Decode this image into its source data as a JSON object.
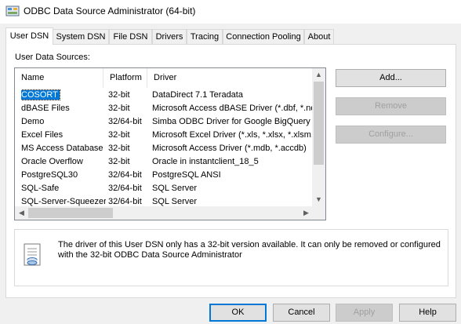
{
  "window": {
    "title": "ODBC Data Source Administrator (64-bit)"
  },
  "tabs": [
    {
      "label": "User DSN",
      "active": true
    },
    {
      "label": "System DSN"
    },
    {
      "label": "File DSN"
    },
    {
      "label": "Drivers"
    },
    {
      "label": "Tracing"
    },
    {
      "label": "Connection Pooling"
    },
    {
      "label": "About"
    }
  ],
  "user_dsn": {
    "section_label": "User Data Sources:",
    "columns": [
      "Name",
      "Platform",
      "Driver"
    ],
    "rows": [
      {
        "name": "COSORT",
        "platform": "32-bit",
        "driver": "DataDirect 7.1 Teradata"
      },
      {
        "name": "dBASE Files",
        "platform": "32-bit",
        "driver": "Microsoft Access dBASE Driver (*.dbf, *.ndx"
      },
      {
        "name": "Demo",
        "platform": "32/64-bit",
        "driver": "Simba ODBC Driver for Google BigQuery"
      },
      {
        "name": "Excel Files",
        "platform": "32-bit",
        "driver": "Microsoft Excel Driver (*.xls, *.xlsx, *.xlsm, *.x"
      },
      {
        "name": "MS Access Database",
        "platform": "32-bit",
        "driver": "Microsoft Access Driver (*.mdb, *.accdb)"
      },
      {
        "name": "Oracle Overflow",
        "platform": "32-bit",
        "driver": "Oracle in instantclient_18_5"
      },
      {
        "name": "PostgreSQL30",
        "platform": "32/64-bit",
        "driver": "PostgreSQL ANSI"
      },
      {
        "name": "SQL-Safe",
        "platform": "32/64-bit",
        "driver": "SQL Server"
      },
      {
        "name": "SQL-Server-Squeezer",
        "platform": "32/64-bit",
        "driver": "SQL Server"
      }
    ],
    "selected_index": 0,
    "buttons": {
      "add": "Add...",
      "remove": "Remove",
      "configure": "Configure..."
    },
    "info_text": "The driver of this User DSN only has a 32-bit version available. It can only be removed or configured with the 32-bit ODBC Data Source Administrator"
  },
  "footer": {
    "ok": "OK",
    "cancel": "Cancel",
    "apply": "Apply",
    "help": "Help"
  },
  "icons": {
    "title": "odbc-app-icon",
    "info": "document-info-icon",
    "scroll_up": "▲",
    "scroll_down": "▼",
    "scroll_left": "◀",
    "scroll_right": "▶"
  },
  "colors": {
    "selection": "#0078d7",
    "default_button_border": "#0078d7",
    "disabled_text": "#a0a0a0"
  }
}
